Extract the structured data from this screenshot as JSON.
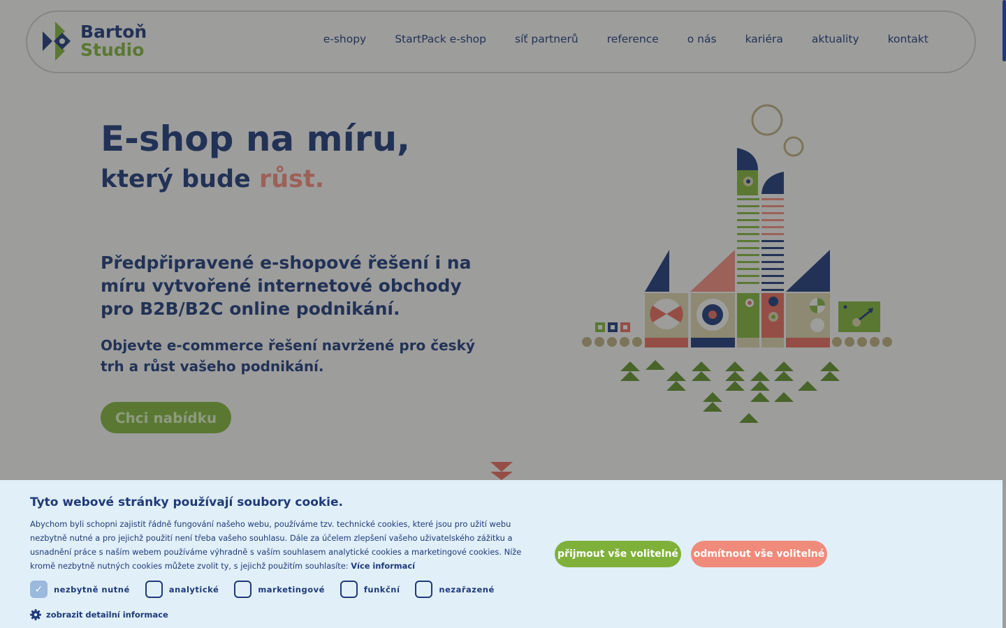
{
  "brand": {
    "line1": "Bartoň",
    "line2": "Studio"
  },
  "nav": [
    {
      "label": "e-shopy"
    },
    {
      "label": "StartPack e-shop"
    },
    {
      "label": "síť partnerů"
    },
    {
      "label": "reference"
    },
    {
      "label": "o nás"
    },
    {
      "label": "kariéra"
    },
    {
      "label": "aktuality"
    },
    {
      "label": "kontakt"
    }
  ],
  "hero": {
    "title": "E-shop na míru,",
    "subtitle_prefix": "který bude",
    "subtitle_accent": "růst.",
    "lead": "Předpřipravené e-shopové řešení i na míru vytvořené internetové obchody pro B2B/B2C online podnikání.",
    "sub": "Objevte e-commerce řešení navržené pro český trh a růst vašeho podnikání.",
    "cta": "Chci nabídku"
  },
  "cookie": {
    "title": "Tyto webové stránky používají soubory cookie.",
    "text": "Abychom byli schopni zajistit řádně fungování našeho webu, používáme tzv. technické cookies, které jsou pro užití webu nezbytně nutné a pro jejichž použití není třeba vašeho souhlasu. Dále za účelem zlepšení vašeho uživatelského zážitku a usnadnění práce s naším webem používáme výhradně s vaším souhlasem analytické cookies a marketingové cookies. Níže kromě nezbytně nutných cookies můžete zvolit ty, s jejichž použitím souhlasíte:",
    "more_link": "Více informací",
    "options": [
      {
        "label": "nezbytně nutné",
        "checked": true
      },
      {
        "label": "analytické",
        "checked": false
      },
      {
        "label": "marketingové",
        "checked": false
      },
      {
        "label": "funkční",
        "checked": false
      },
      {
        "label": "nezařazené",
        "checked": false
      }
    ],
    "detail_link": "zobrazit detailní informace",
    "accept": "přijmout vše volitelné",
    "reject": "odmítnout vše volitelné"
  },
  "colors": {
    "brand_blue": "#1e3a78",
    "brand_green": "#7fb13a",
    "accent_salmon": "#f08a7a",
    "cookie_bg": "#e1eff9"
  }
}
